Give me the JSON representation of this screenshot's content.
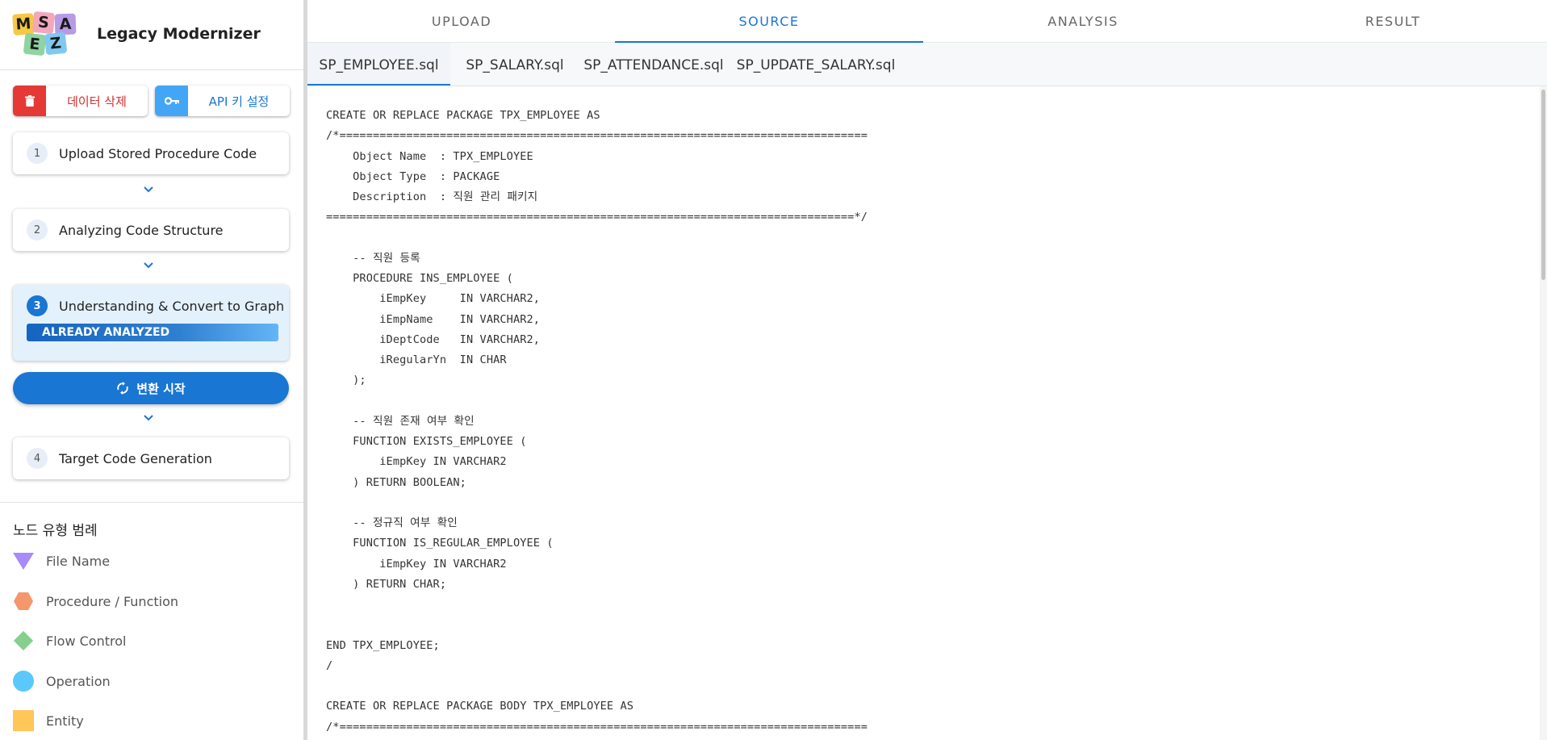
{
  "app": {
    "title": "Legacy Modernizer",
    "logo_letters": [
      "M",
      "S",
      "A",
      "E",
      "Z"
    ]
  },
  "actions": {
    "delete_label": "데이터 삭제",
    "api_key_label": "API 키 설정"
  },
  "steps": [
    {
      "num": "1",
      "title": "Upload Stored Procedure Code"
    },
    {
      "num": "2",
      "title": "Analyzing Code Structure"
    },
    {
      "num": "3",
      "title": "Understanding & Convert to Graph",
      "badge": "ALREADY ANALYZED"
    },
    {
      "num": "4",
      "title": "Target Code Generation"
    }
  ],
  "convert_button": "변환 시작",
  "legend": {
    "title": "노드 유형 범례",
    "items": [
      {
        "label": "File Name",
        "shape": "triangle-down-icon",
        "color": "#a78bfa"
      },
      {
        "label": "Procedure / Function",
        "shape": "hexagon-icon",
        "color": "#f4976c"
      },
      {
        "label": "Flow Control",
        "shape": "diamond-icon",
        "color": "#86cf8e"
      },
      {
        "label": "Operation",
        "shape": "circle-icon",
        "color": "#5ac8fa"
      },
      {
        "label": "Entity",
        "shape": "square-icon",
        "color": "#ffc658"
      }
    ]
  },
  "top_tabs": [
    "UPLOAD",
    "SOURCE",
    "ANALYSIS",
    "RESULT"
  ],
  "active_top_tab": "SOURCE",
  "file_tabs": [
    "SP_EMPLOYEE.sql",
    "SP_SALARY.sql",
    "SP_ATTENDANCE.sql",
    "SP_UPDATE_SALARY.sql"
  ],
  "active_file_tab": "SP_EMPLOYEE.sql",
  "code_lines": [
    "CREATE OR REPLACE PACKAGE TPX_EMPLOYEE AS",
    "/*===============================================================================",
    "    Object Name  : TPX_EMPLOYEE",
    "    Object Type  : PACKAGE",
    "    Description  : 직원 관리 패키지",
    "===============================================================================*/",
    "",
    "    -- 직원 등록",
    "    PROCEDURE INS_EMPLOYEE (",
    "        iEmpKey     IN VARCHAR2,",
    "        iEmpName    IN VARCHAR2,",
    "        iDeptCode   IN VARCHAR2,",
    "        iRegularYn  IN CHAR",
    "    );",
    "",
    "    -- 직원 존재 여부 확인",
    "    FUNCTION EXISTS_EMPLOYEE (",
    "        iEmpKey IN VARCHAR2",
    "    ) RETURN BOOLEAN;",
    "",
    "    -- 정규직 여부 확인",
    "    FUNCTION IS_REGULAR_EMPLOYEE (",
    "        iEmpKey IN VARCHAR2",
    "    ) RETURN CHAR;",
    "",
    "",
    "END TPX_EMPLOYEE;",
    "/",
    "",
    "CREATE OR REPLACE PACKAGE BODY TPX_EMPLOYEE AS",
    "/*==============================================================================="
  ],
  "colors": {
    "accent": "#1976d2",
    "danger": "#e53935",
    "info": "#42a5f5"
  }
}
